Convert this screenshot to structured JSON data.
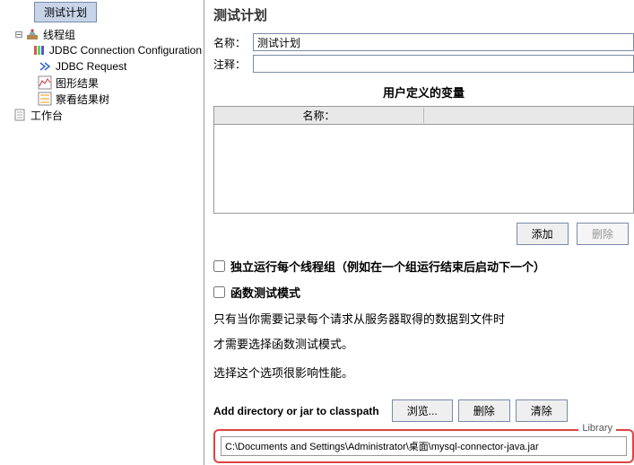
{
  "tab_label": "测试计划",
  "tree": {
    "n0": "线程组",
    "n1": "JDBC Connection Configuration",
    "n2": "JDBC Request",
    "n3": "图形结果",
    "n4": "察看结果树",
    "n5": "工作台"
  },
  "panel": {
    "title": "测试计划",
    "name_label": "名称：",
    "name_value": "测试计划",
    "comment_label": "注释：",
    "comment_value": ""
  },
  "vars": {
    "section_title": "用户定义的变量",
    "col_name": "名称：",
    "add_btn": "添加",
    "del_btn": "删除"
  },
  "options": {
    "independent_threads": "独立运行每个线程组（例如在一个组运行结束后启动下一个）",
    "func_mode": "函数测试模式",
    "desc1": "只有当你需要记录每个请求从服务器取得的数据到文件时",
    "desc2": "才需要选择函数测试模式。",
    "desc3": "选择这个选项很影响性能。"
  },
  "classpath": {
    "label": "Add directory or jar to classpath",
    "browse": "浏览...",
    "delete": "删除",
    "clear": "清除",
    "library_legend": "Library",
    "library_item": "C:\\Documents and Settings\\Administrator\\桌面\\mysql-connector-java.jar"
  }
}
